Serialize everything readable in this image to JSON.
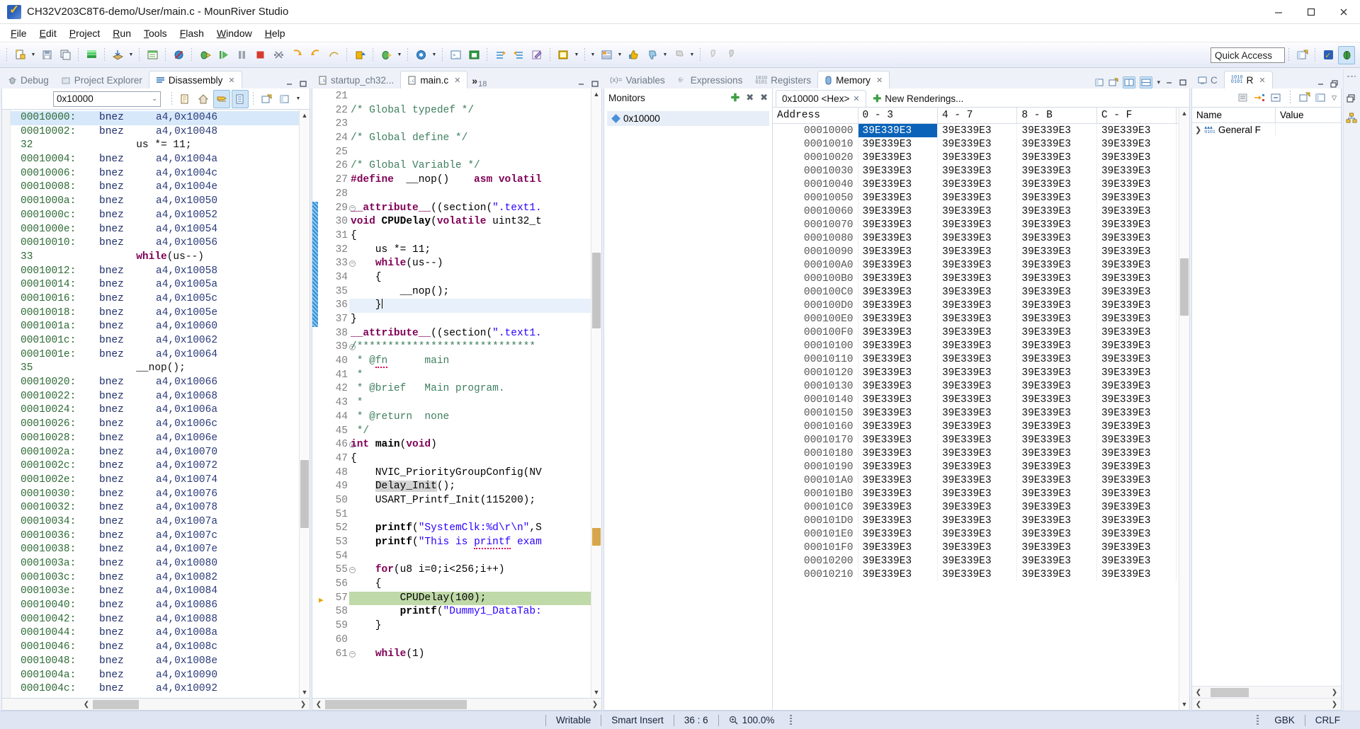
{
  "window": {
    "title": "CH32V203C8T6-demo/User/main.c - MounRiver Studio",
    "app_icon": "mounriver-logo-icon",
    "minimize": "─",
    "maximize": "☐",
    "close": "✕"
  },
  "menu": {
    "items": [
      {
        "label": "File",
        "mnemonic": "F"
      },
      {
        "label": "Edit",
        "mnemonic": "E"
      },
      {
        "label": "Project",
        "mnemonic": "P"
      },
      {
        "label": "Run",
        "mnemonic": "R"
      },
      {
        "label": "Tools",
        "mnemonic": "T"
      },
      {
        "label": "Flash",
        "mnemonic": "F"
      },
      {
        "label": "Window",
        "mnemonic": "W"
      },
      {
        "label": "Help",
        "mnemonic": "H"
      }
    ]
  },
  "toolbar": {
    "quick_access_placeholder": "Quick Access",
    "quick_access_value": "Quick Access"
  },
  "left_panel": {
    "tabs": [
      {
        "label": "Debug",
        "icon": "bug-icon",
        "active": false
      },
      {
        "label": "Project Explorer",
        "icon": "project-explorer-icon",
        "active": false
      },
      {
        "label": "Disassembly",
        "icon": "disassembly-icon",
        "active": true
      }
    ],
    "address_value": "0x10000",
    "lines": [
      {
        "type": "asm",
        "addr": "00010000:",
        "mnem": "bnez",
        "op": "a4,0x10046",
        "selected": true
      },
      {
        "type": "asm",
        "addr": "00010002:",
        "mnem": "bnez",
        "op": "a4,0x10048"
      },
      {
        "type": "src",
        "no": "32",
        "text": "us *= 11;"
      },
      {
        "type": "asm",
        "addr": "00010004:",
        "mnem": "bnez",
        "op": "a4,0x1004a"
      },
      {
        "type": "asm",
        "addr": "00010006:",
        "mnem": "bnez",
        "op": "a4,0x1004c"
      },
      {
        "type": "asm",
        "addr": "00010008:",
        "mnem": "bnez",
        "op": "a4,0x1004e"
      },
      {
        "type": "asm",
        "addr": "0001000a:",
        "mnem": "bnez",
        "op": "a4,0x10050"
      },
      {
        "type": "asm",
        "addr": "0001000c:",
        "mnem": "bnez",
        "op": "a4,0x10052"
      },
      {
        "type": "asm",
        "addr": "0001000e:",
        "mnem": "bnez",
        "op": "a4,0x10054"
      },
      {
        "type": "asm",
        "addr": "00010010:",
        "mnem": "bnez",
        "op": "a4,0x10056"
      },
      {
        "type": "src",
        "no": "33",
        "text": "while(us--)",
        "kw": "while"
      },
      {
        "type": "asm",
        "addr": "00010012:",
        "mnem": "bnez",
        "op": "a4,0x10058"
      },
      {
        "type": "asm",
        "addr": "00010014:",
        "mnem": "bnez",
        "op": "a4,0x1005a"
      },
      {
        "type": "asm",
        "addr": "00010016:",
        "mnem": "bnez",
        "op": "a4,0x1005c"
      },
      {
        "type": "asm",
        "addr": "00010018:",
        "mnem": "bnez",
        "op": "a4,0x1005e"
      },
      {
        "type": "asm",
        "addr": "0001001a:",
        "mnem": "bnez",
        "op": "a4,0x10060"
      },
      {
        "type": "asm",
        "addr": "0001001c:",
        "mnem": "bnez",
        "op": "a4,0x10062"
      },
      {
        "type": "asm",
        "addr": "0001001e:",
        "mnem": "bnez",
        "op": "a4,0x10064"
      },
      {
        "type": "src",
        "no": "35",
        "text": "__nop();"
      },
      {
        "type": "asm",
        "addr": "00010020:",
        "mnem": "bnez",
        "op": "a4,0x10066"
      },
      {
        "type": "asm",
        "addr": "00010022:",
        "mnem": "bnez",
        "op": "a4,0x10068"
      },
      {
        "type": "asm",
        "addr": "00010024:",
        "mnem": "bnez",
        "op": "a4,0x1006a"
      },
      {
        "type": "asm",
        "addr": "00010026:",
        "mnem": "bnez",
        "op": "a4,0x1006c"
      },
      {
        "type": "asm",
        "addr": "00010028:",
        "mnem": "bnez",
        "op": "a4,0x1006e"
      },
      {
        "type": "asm",
        "addr": "0001002a:",
        "mnem": "bnez",
        "op": "a4,0x10070"
      },
      {
        "type": "asm",
        "addr": "0001002c:",
        "mnem": "bnez",
        "op": "a4,0x10072"
      },
      {
        "type": "asm",
        "addr": "0001002e:",
        "mnem": "bnez",
        "op": "a4,0x10074"
      },
      {
        "type": "asm",
        "addr": "00010030:",
        "mnem": "bnez",
        "op": "a4,0x10076"
      },
      {
        "type": "asm",
        "addr": "00010032:",
        "mnem": "bnez",
        "op": "a4,0x10078"
      },
      {
        "type": "asm",
        "addr": "00010034:",
        "mnem": "bnez",
        "op": "a4,0x1007a"
      },
      {
        "type": "asm",
        "addr": "00010036:",
        "mnem": "bnez",
        "op": "a4,0x1007c"
      },
      {
        "type": "asm",
        "addr": "00010038:",
        "mnem": "bnez",
        "op": "a4,0x1007e"
      },
      {
        "type": "asm",
        "addr": "0001003a:",
        "mnem": "bnez",
        "op": "a4,0x10080"
      },
      {
        "type": "asm",
        "addr": "0001003c:",
        "mnem": "bnez",
        "op": "a4,0x10082"
      },
      {
        "type": "asm",
        "addr": "0001003e:",
        "mnem": "bnez",
        "op": "a4,0x10084"
      },
      {
        "type": "asm",
        "addr": "00010040:",
        "mnem": "bnez",
        "op": "a4,0x10086"
      },
      {
        "type": "asm",
        "addr": "00010042:",
        "mnem": "bnez",
        "op": "a4,0x10088"
      },
      {
        "type": "asm",
        "addr": "00010044:",
        "mnem": "bnez",
        "op": "a4,0x1008a"
      },
      {
        "type": "asm",
        "addr": "00010046:",
        "mnem": "bnez",
        "op": "a4,0x1008c"
      },
      {
        "type": "asm",
        "addr": "00010048:",
        "mnem": "bnez",
        "op": "a4,0x1008e"
      },
      {
        "type": "asm",
        "addr": "0001004a:",
        "mnem": "bnez",
        "op": "a4,0x10090"
      },
      {
        "type": "asm",
        "addr": "0001004c:",
        "mnem": "bnez",
        "op": "a4,0x10092"
      }
    ]
  },
  "editor": {
    "tabs": [
      {
        "label": "startup_ch32...",
        "icon": "assembly-file-icon",
        "active": false
      },
      {
        "label": "main.c",
        "icon": "c-file-icon",
        "active": true
      }
    ],
    "overflow_label": "18",
    "overflow_icon": "chevron-double-right-icon",
    "lines": [
      {
        "no": "21",
        "html": ""
      },
      {
        "no": "22",
        "html": "<span class='cm'>/* Global typedef */</span>"
      },
      {
        "no": "23",
        "html": ""
      },
      {
        "no": "24",
        "html": "<span class='cm'>/* Global define */</span>"
      },
      {
        "no": "25",
        "html": ""
      },
      {
        "no": "26",
        "html": "<span class='cm'>/* Global Variable */</span>"
      },
      {
        "no": "27",
        "html": "<span class='pp'>#define</span>  __nop()    <span class='pp'>asm volatil</span>"
      },
      {
        "no": "28",
        "html": ""
      },
      {
        "no": "29",
        "fold": true,
        "change": true,
        "html": "<span class='kw'>__attribute__</span>((section(<span class='st'>\".text1.</span>"
      },
      {
        "no": "30",
        "change": true,
        "html": "<span class='kw'>void</span> <span class='fn'>CPUDelay</span>(<span class='kw'>volatile</span> uint32_t"
      },
      {
        "no": "31",
        "change": true,
        "html": "{"
      },
      {
        "no": "32",
        "change": true,
        "html": "    us *= 11;"
      },
      {
        "no": "33",
        "fold": true,
        "change": true,
        "html": "    <span class='kw'>while</span>(us--)"
      },
      {
        "no": "34",
        "change": true,
        "html": "    {"
      },
      {
        "no": "35",
        "change": true,
        "html": "        __nop();"
      },
      {
        "no": "36",
        "change": true,
        "cur": true,
        "html": "    }<span class='caretbar'></span>"
      },
      {
        "no": "37",
        "change": true,
        "html": "}"
      },
      {
        "no": "38",
        "html": "<span class='kw'>__attribute__</span>((section(<span class='st'>\".text1.</span>"
      },
      {
        "no": "39",
        "fold": true,
        "html": "<span class='cm'>/*****************************</span>"
      },
      {
        "no": "40",
        "html": "<span class='cm'> * @<span class='sq'>fn</span>      main</span>"
      },
      {
        "no": "41",
        "html": "<span class='cm'> *</span>"
      },
      {
        "no": "42",
        "html": "<span class='cm'> * @brief   Main program.</span>"
      },
      {
        "no": "43",
        "html": "<span class='cm'> *</span>"
      },
      {
        "no": "44",
        "html": "<span class='cm'> * @return  none</span>"
      },
      {
        "no": "45",
        "html": "<span class='cm'> */</span>"
      },
      {
        "no": "46",
        "fold": true,
        "html": "<span class='kw'>int</span> <span class='fn'>main</span>(<span class='kw'>void</span>)"
      },
      {
        "no": "47",
        "html": "{"
      },
      {
        "no": "48",
        "html": "    NVIC_PriorityGroupConfig(NV"
      },
      {
        "no": "49",
        "html": "    <span class='occ'>Delay_Init</span>();"
      },
      {
        "no": "50",
        "html": "    USART_Printf_Init(115200);"
      },
      {
        "no": "51",
        "html": ""
      },
      {
        "no": "52",
        "html": "    <span class='fn'>printf</span>(<span class='st'>\"SystemClk:%d\\r\\n\"</span>,S"
      },
      {
        "no": "53",
        "html": "    <span class='fn'>printf</span>(<span class='st'>\"This is <span class='sq'>printf</span> exam</span>"
      },
      {
        "no": "54",
        "html": ""
      },
      {
        "no": "55",
        "fold": true,
        "html": "    <span class='kw'>for</span>(u8 i=0;i&lt;256;i++)"
      },
      {
        "no": "56",
        "html": "    {"
      },
      {
        "no": "57",
        "bp": true,
        "hl": true,
        "html": "        CPUDelay(100);"
      },
      {
        "no": "58",
        "html": "        <span class='fn'>printf</span>(<span class='st'>\"Dummy1_DataTab:</span>"
      },
      {
        "no": "59",
        "html": "    }"
      },
      {
        "no": "60",
        "html": ""
      },
      {
        "no": "61",
        "fold": true,
        "html": "    <span class='kw'>while</span>(1)"
      }
    ]
  },
  "memory_panel": {
    "tabs": [
      {
        "label": "Variables",
        "icon": "variables-icon",
        "active": false
      },
      {
        "label": "Expressions",
        "icon": "expressions-icon",
        "active": false
      },
      {
        "label": "Registers",
        "icon": "registers-icon",
        "active": false
      },
      {
        "label": "Memory",
        "icon": "memory-icon",
        "active": true
      }
    ],
    "monitors_label": "Monitors",
    "monitors_actions": [
      {
        "name": "add-monitor-icon",
        "glyph": "+"
      },
      {
        "name": "remove-monitor-icon",
        "glyph": "✖"
      },
      {
        "name": "remove-all-monitors-icon",
        "glyph": "✖"
      }
    ],
    "monitor_items": [
      {
        "label": "0x10000"
      }
    ],
    "renderings_tabs": [
      {
        "label": "0x10000 <Hex>",
        "active": true
      },
      {
        "label": "New Renderings...",
        "active": false,
        "icon": "plus-icon"
      }
    ],
    "table": {
      "headers": [
        "Address",
        "0 - 3",
        "4 - 7",
        "8 - B",
        "C - F"
      ],
      "selected_cell": {
        "row": 0,
        "col": 1
      },
      "rows": [
        {
          "address": "00010000",
          "cells": [
            "39E339E3",
            "39E339E3",
            "39E339E3",
            "39E339E3"
          ]
        },
        {
          "address": "00010010",
          "cells": [
            "39E339E3",
            "39E339E3",
            "39E339E3",
            "39E339E3"
          ]
        },
        {
          "address": "00010020",
          "cells": [
            "39E339E3",
            "39E339E3",
            "39E339E3",
            "39E339E3"
          ]
        },
        {
          "address": "00010030",
          "cells": [
            "39E339E3",
            "39E339E3",
            "39E339E3",
            "39E339E3"
          ]
        },
        {
          "address": "00010040",
          "cells": [
            "39E339E3",
            "39E339E3",
            "39E339E3",
            "39E339E3"
          ]
        },
        {
          "address": "00010050",
          "cells": [
            "39E339E3",
            "39E339E3",
            "39E339E3",
            "39E339E3"
          ]
        },
        {
          "address": "00010060",
          "cells": [
            "39E339E3",
            "39E339E3",
            "39E339E3",
            "39E339E3"
          ]
        },
        {
          "address": "00010070",
          "cells": [
            "39E339E3",
            "39E339E3",
            "39E339E3",
            "39E339E3"
          ]
        },
        {
          "address": "00010080",
          "cells": [
            "39E339E3",
            "39E339E3",
            "39E339E3",
            "39E339E3"
          ]
        },
        {
          "address": "00010090",
          "cells": [
            "39E339E3",
            "39E339E3",
            "39E339E3",
            "39E339E3"
          ]
        },
        {
          "address": "000100A0",
          "cells": [
            "39E339E3",
            "39E339E3",
            "39E339E3",
            "39E339E3"
          ]
        },
        {
          "address": "000100B0",
          "cells": [
            "39E339E3",
            "39E339E3",
            "39E339E3",
            "39E339E3"
          ]
        },
        {
          "address": "000100C0",
          "cells": [
            "39E339E3",
            "39E339E3",
            "39E339E3",
            "39E339E3"
          ]
        },
        {
          "address": "000100D0",
          "cells": [
            "39E339E3",
            "39E339E3",
            "39E339E3",
            "39E339E3"
          ]
        },
        {
          "address": "000100E0",
          "cells": [
            "39E339E3",
            "39E339E3",
            "39E339E3",
            "39E339E3"
          ]
        },
        {
          "address": "000100F0",
          "cells": [
            "39E339E3",
            "39E339E3",
            "39E339E3",
            "39E339E3"
          ]
        },
        {
          "address": "00010100",
          "cells": [
            "39E339E3",
            "39E339E3",
            "39E339E3",
            "39E339E3"
          ]
        },
        {
          "address": "00010110",
          "cells": [
            "39E339E3",
            "39E339E3",
            "39E339E3",
            "39E339E3"
          ]
        },
        {
          "address": "00010120",
          "cells": [
            "39E339E3",
            "39E339E3",
            "39E339E3",
            "39E339E3"
          ]
        },
        {
          "address": "00010130",
          "cells": [
            "39E339E3",
            "39E339E3",
            "39E339E3",
            "39E339E3"
          ]
        },
        {
          "address": "00010140",
          "cells": [
            "39E339E3",
            "39E339E3",
            "39E339E3",
            "39E339E3"
          ]
        },
        {
          "address": "00010150",
          "cells": [
            "39E339E3",
            "39E339E3",
            "39E339E3",
            "39E339E3"
          ]
        },
        {
          "address": "00010160",
          "cells": [
            "39E339E3",
            "39E339E3",
            "39E339E3",
            "39E339E3"
          ]
        },
        {
          "address": "00010170",
          "cells": [
            "39E339E3",
            "39E339E3",
            "39E339E3",
            "39E339E3"
          ]
        },
        {
          "address": "00010180",
          "cells": [
            "39E339E3",
            "39E339E3",
            "39E339E3",
            "39E339E3"
          ]
        },
        {
          "address": "00010190",
          "cells": [
            "39E339E3",
            "39E339E3",
            "39E339E3",
            "39E339E3"
          ]
        },
        {
          "address": "000101A0",
          "cells": [
            "39E339E3",
            "39E339E3",
            "39E339E3",
            "39E339E3"
          ]
        },
        {
          "address": "000101B0",
          "cells": [
            "39E339E3",
            "39E339E3",
            "39E339E3",
            "39E339E3"
          ]
        },
        {
          "address": "000101C0",
          "cells": [
            "39E339E3",
            "39E339E3",
            "39E339E3",
            "39E339E3"
          ]
        },
        {
          "address": "000101D0",
          "cells": [
            "39E339E3",
            "39E339E3",
            "39E339E3",
            "39E339E3"
          ]
        },
        {
          "address": "000101E0",
          "cells": [
            "39E339E3",
            "39E339E3",
            "39E339E3",
            "39E339E3"
          ]
        },
        {
          "address": "000101F0",
          "cells": [
            "39E339E3",
            "39E339E3",
            "39E339E3",
            "39E339E3"
          ]
        },
        {
          "address": "00010200",
          "cells": [
            "39E339E3",
            "39E339E3",
            "39E339E3",
            "39E339E3"
          ]
        },
        {
          "address": "00010210",
          "cells": [
            "39E339E3",
            "39E339E3",
            "39E339E3",
            "39E339E3"
          ]
        }
      ]
    }
  },
  "right_panel": {
    "tabs": [
      {
        "label": "C",
        "icon": "console-icon",
        "active": false
      },
      {
        "label": "R",
        "icon": "registers-icon",
        "active": true
      }
    ],
    "headers": {
      "name": "Name",
      "value": "Value"
    },
    "rows": [
      {
        "name": "General F",
        "icon": "register-group-icon",
        "value": "",
        "expander": ">"
      }
    ]
  },
  "statusbar": {
    "writable": "Writable",
    "insert_mode": "Smart Insert",
    "cursor_position": "36 : 6",
    "zoom": "100.0%",
    "zoom_icon": "zoom-icon",
    "encoding": "GBK",
    "line_delimiter": "CRLF"
  }
}
